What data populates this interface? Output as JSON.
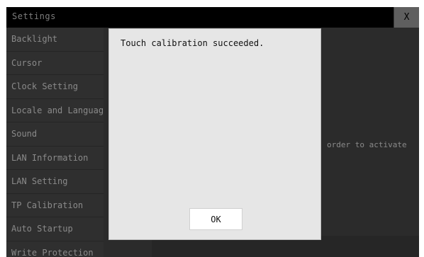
{
  "window": {
    "title": "Settings",
    "close_label": "X"
  },
  "sidebar": {
    "items": [
      {
        "label": "Backlight"
      },
      {
        "label": "Cursor"
      },
      {
        "label": "Clock Setting"
      },
      {
        "label": "Locale and Language"
      },
      {
        "label": "Sound"
      },
      {
        "label": "LAN Information"
      },
      {
        "label": "LAN Setting"
      },
      {
        "label": "TP Calibration"
      },
      {
        "label": "Auto Startup"
      },
      {
        "label": "Write Protection"
      }
    ]
  },
  "content": {
    "partial_text": "order to activate"
  },
  "dialog": {
    "message": "Touch calibration succeeded.",
    "ok_label": "OK"
  }
}
